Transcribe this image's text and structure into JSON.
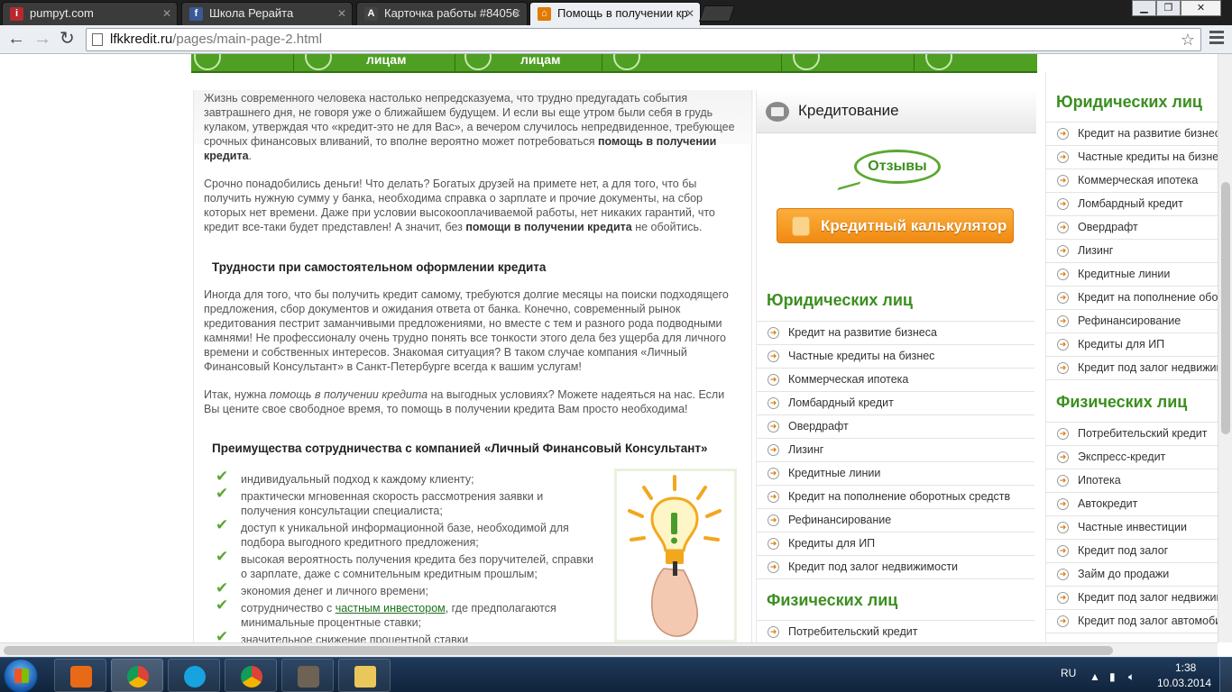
{
  "browser": {
    "tabs": [
      {
        "title": "pumpyt.com",
        "favicon_color": "#b8282e",
        "favicon_letter": "i",
        "active": false
      },
      {
        "title": "Школа Рерайта",
        "favicon_color": "#3b5998",
        "favicon_letter": "f",
        "active": false
      },
      {
        "title": "Карточка работы #84056",
        "favicon_color": "#444444",
        "favicon_letter": "A",
        "active": false
      },
      {
        "title": "Помощь в получении кр",
        "favicon_color": "#e07a00",
        "favicon_letter": "⌂",
        "active": true
      }
    ],
    "url_host": "lfkkredit.ru",
    "url_path": "/pages/main-page-2.html"
  },
  "topnav": {
    "items": [
      {
        "label": ""
      },
      {
        "label": "лицам"
      },
      {
        "label": "лицам"
      },
      {
        "label": ""
      },
      {
        "label": ""
      },
      {
        "label": ""
      }
    ]
  },
  "article": {
    "intro_text_before": "Жизнь современного человека настолько непредсказуема, что трудно предугадать события завтрашнего дня, не говоря уже о ближайшем будущем. И если вы еще утром были себя в грудь кулаком, утверждая что «кредит-это не для Вас», а вечером случилось непредвиденное, требующее срочных финансовых вливаний, то вполне вероятно может потребоваться ",
    "intro_bold": "помощь в получении кредита",
    "intro_text_after": ".",
    "p2_before": "Срочно понадобились деньги! Что делать? Богатых друзей на примете нет, а для того, что бы получить нужную сумму у банка, необходима справка о зарплате и прочие документы, на сбор которых нет времени. Даже при условии высокооплачиваемой работы, нет никаких гарантий, что кредит все-таки будет представлен! А значит, без ",
    "p2_bold": "помощи в получении кредита",
    "p2_after": " не обойтись.",
    "heading1": "Трудности при самостоятельном оформлении кредита",
    "p3": "Иногда для того, что бы получить кредит самому, требуются долгие месяцы на поиски подходящего предложения, сбор документов и ожидания ответа от банка. Конечно, современный рынок кредитования пестрит заманчивыми предложениями, но вместе с тем  и разного рода подводными камнями! Не профессионалу очень трудно понять все тонкости этого дела без ущерба для личного времени и собственных интересов. Знакомая ситуация? В таком случае компания «Личный Финансовый Консультант» в Санкт-Петербурге всегда к вашим услугам!",
    "p4_before": "Итак, нужна ",
    "p4_italic": "помощь в получении кредита",
    "p4_after": " на выгодных условиях? Можете надеяться на нас. Если Вы цените свое свободное время, то помощь в получении кредита Вам просто необходима!",
    "heading2": "Преимущества сотрудничества с компанией «Личный Финансовый Консультант»",
    "advantages": [
      {
        "text": "индивидуальный подход к каждому клиенту;"
      },
      {
        "text": "практически мгновенная скорость рассмотрения заявки и получения консультации специалиста;"
      },
      {
        "text": "доступ к уникальной информационной базе, необходимой для подбора выгодного кредитного предложения;"
      },
      {
        "text": "высокая вероятность получения кредита без поручителей, справки о зарплате, даже с сомнительным кредитным прошлым;"
      },
      {
        "text": "экономия денег и личного времени;"
      },
      {
        "text_before": "сотрудничество с ",
        "link": "частным инвестором",
        "text_after": ", где предполагаются минимальные процентные ставки;"
      },
      {
        "text": "значительное снижение процентной ставки"
      }
    ]
  },
  "midbar": {
    "title": "Кредитование",
    "reviews_label": "Отзывы",
    "calc_label": "Кредитный калькулятор",
    "legal_title": "Юридических лиц",
    "legal_items": [
      "Кредит на развитие бизнеса",
      "Частные кредиты на бизнес",
      "Коммерческая ипотека",
      "Ломбардный кредит",
      "Овердрафт",
      "Лизинг",
      "Кредитные линии",
      "Кредит на пополнение оборотных средств",
      "Рефинансирование",
      "Кредиты для ИП",
      "Кредит под залог недвижимости"
    ],
    "physical_title": "Физических лиц",
    "physical_items": [
      "Потребительский кредит"
    ]
  },
  "rightbar": {
    "legal_title": "Юридических лиц",
    "legal_items": [
      "Кредит на развитие бизнеса",
      "Частные кредиты на бизнес",
      "Коммерческая ипотека",
      "Ломбардный кредит",
      "Овердрафт",
      "Лизинг",
      "Кредитные линии",
      "Кредит на пополнение оборотных средств",
      "Рефинансирование",
      "Кредиты для ИП",
      "Кредит под залог недвижимости"
    ],
    "physical_title": "Физических лиц",
    "physical_items": [
      "Потребительский кредит",
      "Экспресс-кредит",
      "Ипотека",
      "Автокредит",
      "Частные инвестиции",
      "Кредит под залог",
      "Займ до продажи",
      "Кредит под залог недвижимости",
      "Кредит под залог автомобиля"
    ]
  },
  "taskbar": {
    "apps": [
      {
        "name": "media-player",
        "color": "#e96a16",
        "active": false
      },
      {
        "name": "chrome",
        "color": "#3d8f34",
        "active": true
      },
      {
        "name": "skype",
        "color": "#16a3e0",
        "active": false
      },
      {
        "name": "chrome",
        "color": "#3d8f34",
        "active": false
      },
      {
        "name": "gimp",
        "color": "#6d6253",
        "active": false
      },
      {
        "name": "explorer",
        "color": "#e9c75a",
        "active": false
      }
    ],
    "lang": "RU",
    "time": "1:38",
    "date": "10.03.2014"
  }
}
